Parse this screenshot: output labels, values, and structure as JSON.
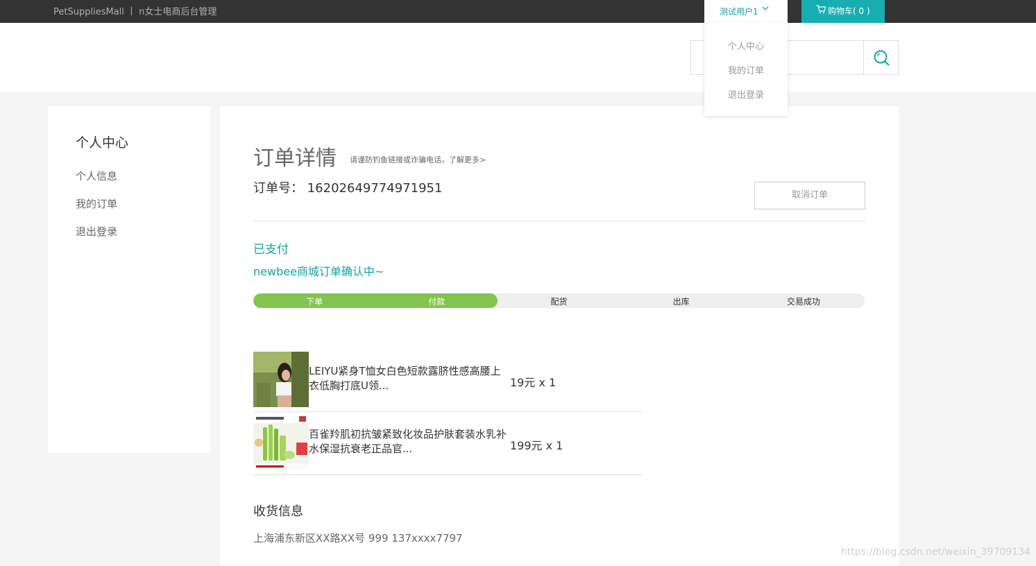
{
  "topbar": {
    "site_title": "PetSuppliesMall  丨 n女士电商后台管理",
    "user_name": "测试用户1",
    "cart_label": "购物车( 0 )"
  },
  "dropdown": {
    "items": [
      "个人中心",
      "我的订单",
      "退出登录"
    ]
  },
  "sidebar": {
    "title": "个人中心",
    "items": [
      "个人信息",
      "我的订单",
      "退出登录"
    ]
  },
  "order": {
    "title": "订单详情",
    "notice": "请谨防钓鱼链接或诈骗电话，了解更多>",
    "number_label": "订单号：",
    "number": "16202649774971951",
    "cancel_label": "取消订单",
    "status": "已支付",
    "status_sub": "newbee商城订单确认中~",
    "progress": {
      "steps": [
        "下单",
        "付款",
        "配货",
        "出库",
        "交易成功"
      ],
      "completed_steps": 2,
      "active_color": "#83c44e"
    },
    "items": [
      {
        "name": "LEIYU紧身T恤女白色短款露脐性感高腰上衣低胸打底U领...",
        "price": "19元 x 1"
      },
      {
        "name": "百雀羚肌初抗皱紧致化妆品护肤套装水乳补水保湿抗衰老正品官...",
        "price": "199元 x 1"
      }
    ]
  },
  "shipping": {
    "title": "收货信息",
    "address": "上海浦东新区XX路XX号 999 137xxxx7797"
  },
  "watermark": "https://blog.csdn.net/weixin_39709134",
  "colors": {
    "accent": "#13a2a5",
    "cart_bg": "#17aeb1",
    "topbar_bg": "#333333",
    "progress_done": "#83c44e"
  }
}
